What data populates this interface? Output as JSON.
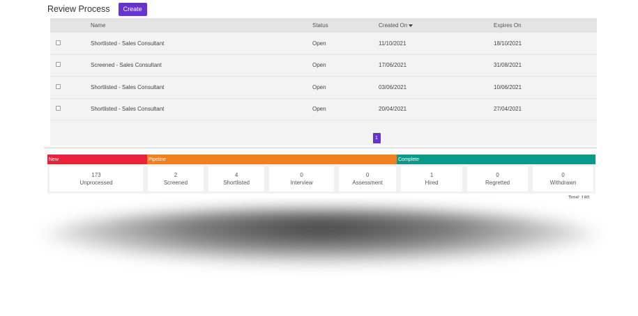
{
  "header": {
    "title": "Review Process",
    "create_label": "Create"
  },
  "table": {
    "columns": [
      "Name",
      "Status",
      "Created On",
      "Expires On"
    ],
    "rows": [
      {
        "name": "Shortlisted - Sales Consultant",
        "status": "Open",
        "created": "11/10/2021",
        "expires": "18/10/2021"
      },
      {
        "name": "Screened - Sales Consultant",
        "status": "Open",
        "created": "17/06/2021",
        "expires": "31/08/2021"
      },
      {
        "name": "Shortlisted - Sales Consultant",
        "status": "Open",
        "created": "03/06/2021",
        "expires": "10/06/2021"
      },
      {
        "name": "Shortlisted - Sales Consultant",
        "status": "Open",
        "created": "20/04/2021",
        "expires": "27/04/2021"
      }
    ]
  },
  "pagination": {
    "current": "1"
  },
  "stages": {
    "bands": [
      {
        "label": "New",
        "color": "#e8223a"
      },
      {
        "label": "Pipeline",
        "color": "#f0801f"
      },
      {
        "label": "Complete",
        "color": "#0a9a8a"
      }
    ],
    "tiles": [
      {
        "count": "173",
        "label": "Unprocessed"
      },
      {
        "count": "2",
        "label": "Screened"
      },
      {
        "count": "4",
        "label": "Shortlisted"
      },
      {
        "count": "0",
        "label": "Interview"
      },
      {
        "count": "0",
        "label": "Assessment"
      },
      {
        "count": "1",
        "label": "Hired"
      },
      {
        "count": "0",
        "label": "Regretted"
      },
      {
        "count": "0",
        "label": "Withdrawn"
      }
    ],
    "total": "Total: 180"
  }
}
